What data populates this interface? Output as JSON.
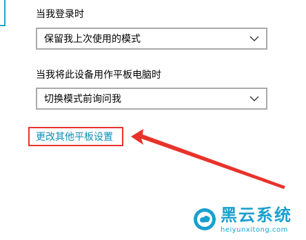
{
  "settings": {
    "login_label": "当我登录时",
    "login_value": "保留我上次使用的模式",
    "tablet_label": "当我将此设备用作平板电脑时",
    "tablet_value": "切换模式前询问我",
    "more_link": "更改其他平板设置"
  },
  "watermark": {
    "title": "黑云系统",
    "url": "heiyunxitong.com"
  },
  "colors": {
    "link": "#0a8fb5",
    "annotation": "#e8332a",
    "watermark": "#1a9fcf"
  },
  "icons": {
    "dropdown": "chevron-down-icon",
    "logo": "cloud-logo-icon"
  }
}
